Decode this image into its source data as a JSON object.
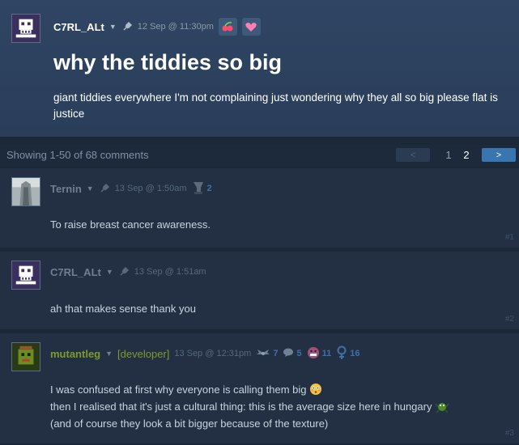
{
  "op": {
    "author": "C7RL_ALt",
    "date": "12 Sep @ 11:30pm",
    "title": "why the tiddies so big",
    "body": "giant tiddies everywhere I'm not complaining just wondering why they all so big please flat is justice",
    "icons": [
      "avatar-skull-icon",
      "pin-icon",
      "cherry-award-icon",
      "heart-award-icon"
    ]
  },
  "paging": {
    "showing": "Showing 1-50 of 68 comments",
    "prev": "<",
    "pages": [
      "1",
      "2"
    ],
    "current": "2",
    "next": ">"
  },
  "comments": [
    {
      "author": "Ternin",
      "date": "13 Sep @ 1:50am",
      "badge_count": "2",
      "text": "To raise breast cancer awareness.",
      "num": "#1"
    },
    {
      "author": "C7RL_ALt",
      "date": "13 Sep @ 1:51am",
      "text": "ah that makes sense thank you",
      "num": "#2"
    },
    {
      "author": "mutantleg",
      "tag": "[developer]",
      "date": "13 Sep @ 12:31pm",
      "badges": [
        "7",
        "5",
        "11",
        "16"
      ],
      "lines": [
        "I was confused at first why everyone is calling them big",
        "then I realised that it's just a cultural thing: this is the average size here in hungary",
        "(and of course they look a bit bigger because of the texture)"
      ],
      "num": "#3"
    }
  ],
  "colors": {
    "background": "#1b2838",
    "op_panel": "#2f4563",
    "comment_panel": "#233044",
    "developer": "#7e9a2a",
    "next_button": "#3976b0"
  }
}
